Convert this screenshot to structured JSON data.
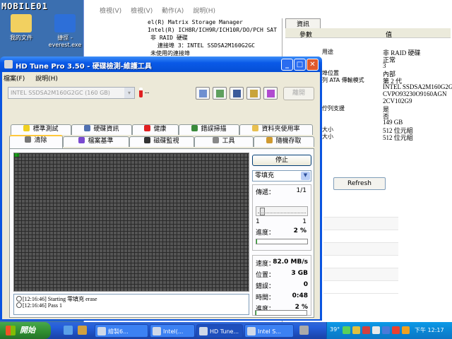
{
  "watermark": {
    "logo": "MOBILE01",
    "tag": "#997189"
  },
  "desktop": {
    "icons": [
      {
        "label": "我的文件"
      },
      {
        "label": "捷徑 - everest.exe"
      }
    ]
  },
  "bg_window": {
    "menu": [
      "檢視(V)",
      "檢視(V)",
      "動作(A)",
      "說明(H)"
    ],
    "tree": [
      "el(R) Matrix Storage Manager",
      "Intel(R) ICH8R/ICH9R/ICH10R/DO/PCH SAT",
      "非 RAID 硬碟",
      "連接埠 3：INTEL SSDSA2M160G2GC",
      "未使用的連接埠"
    ],
    "info_tab": "資訊",
    "info_columns": [
      "參數",
      "值"
    ],
    "info_rows": [
      {
        "k": "用途",
        "v": "非 RAID 硬碟"
      },
      {
        "k": "",
        "v": "正常"
      },
      {
        "k": "",
        "v": "3"
      },
      {
        "k": "埠位置",
        "v": "內部"
      },
      {
        "k": "列 ATA 傳輸模式",
        "v": "第 2 代"
      },
      {
        "k": "",
        "v": "INTEL SSDSA2M160G2G"
      },
      {
        "k": "",
        "v": "CVPO93230O9160AGN"
      },
      {
        "k": "",
        "v": "2CV102G9"
      },
      {
        "k": "佇列支援",
        "v": "是"
      },
      {
        "k": "",
        "v": "否"
      },
      {
        "k": "",
        "v": "149 GB"
      },
      {
        "k": "大小",
        "v": "512 位元組"
      },
      {
        "k": "大小",
        "v": "512 位元組"
      }
    ],
    "refresh_label": "Refresh"
  },
  "hdtune": {
    "title": "HD Tune Pro 3.50 - 硬碟檢測-維護工具",
    "menu": [
      "檔案(F)",
      "說明(H)"
    ],
    "drive": "INTEL SSDSA2M160G2GC (160 GB)",
    "temperature": "--",
    "exit_label": "離開",
    "tabs_row1": [
      "標準測試",
      "硬碟資訊",
      "健康",
      "錯誤掃描",
      "資料夾使用率"
    ],
    "tabs_row2": [
      "清除",
      "檔案基準",
      "磁碟監視",
      "工具",
      "隨機存取"
    ],
    "stop_label": "停止",
    "mode": "零填充",
    "pass_label": "傳遞：",
    "pass_value": "1/1",
    "slider_min": "1",
    "slider_max": "1",
    "progress_label": "進度：",
    "progress_value": "2 %",
    "progress_fraction": 0.02,
    "speed_label": "速度：",
    "speed_value": "82.0 MB/s",
    "position_label": "位置：",
    "position_value": "3 GB",
    "errors_label": "錯誤：",
    "errors_value": "0",
    "time_label": "時間：",
    "time_value": "0:48",
    "progress2_label": "進度：",
    "progress2_value": "2 %",
    "log": [
      "[12:16:46] Starting 零填充 erase",
      "[12:16:46] Pass 1"
    ]
  },
  "taskbar": {
    "start_label": "開始",
    "tasks": [
      "繪製6...",
      "Intel(...",
      "HD Tune...",
      "Intel S..."
    ],
    "tray_temp": "39°",
    "clock": "下午 12:17",
    "colors": {
      "start": "#2f8d2f",
      "bar": "#245edb"
    }
  }
}
